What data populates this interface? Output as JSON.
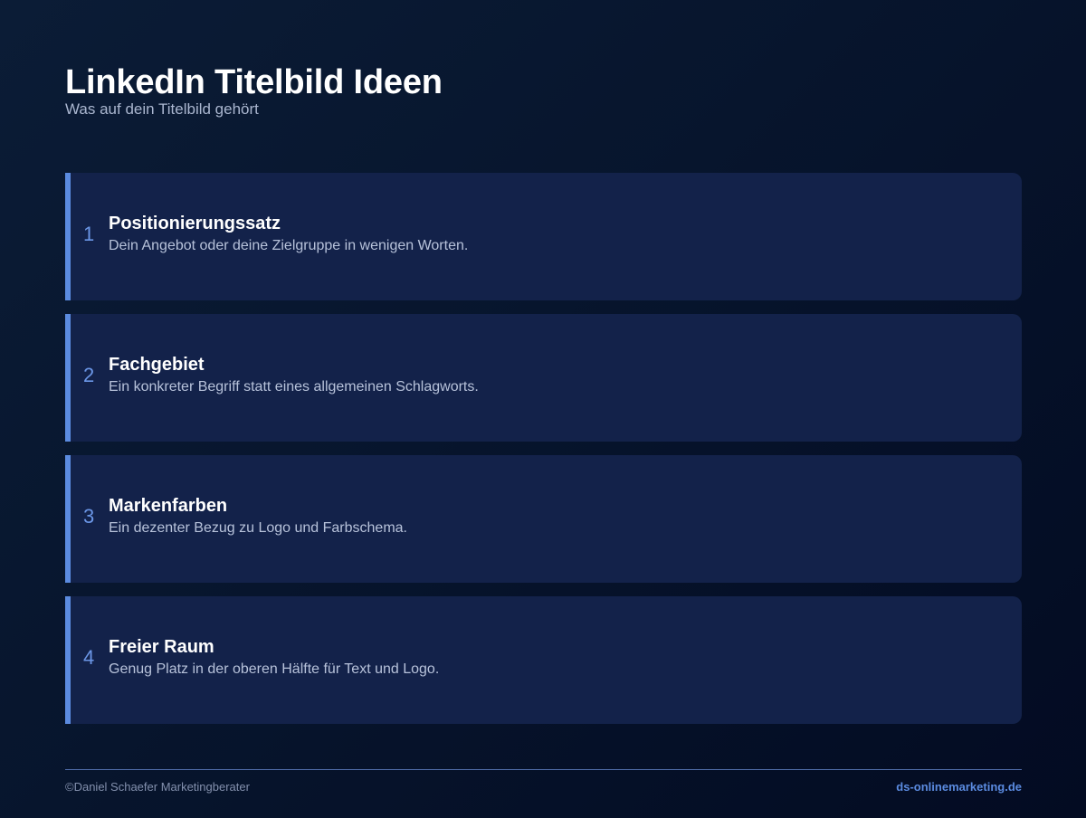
{
  "header": {
    "title": "LinkedIn Titelbild Ideen",
    "subtitle": "Was auf dein Titelbild gehört"
  },
  "items": [
    {
      "number": "1",
      "title": "Positionierungssatz",
      "description": "Dein Angebot oder deine Zielgruppe in wenigen Worten."
    },
    {
      "number": "2",
      "title": "Fachgebiet",
      "description": "Ein konkreter Begriff statt eines allgemeinen Schlagworts."
    },
    {
      "number": "3",
      "title": "Markenfarben",
      "description": "Ein dezenter Bezug zu Logo und Farbschema."
    },
    {
      "number": "4",
      "title": "Freier Raum",
      "description": "Genug Platz in der oberen Hälfte für Text und Logo."
    }
  ],
  "footer": {
    "copyright": "©Daniel Schaefer Marketingberater",
    "website": "ds-onlinemarketing.de"
  },
  "colors": {
    "accent": "#5b8be0",
    "card_background": "#13224a",
    "page_background": "#07152d"
  }
}
